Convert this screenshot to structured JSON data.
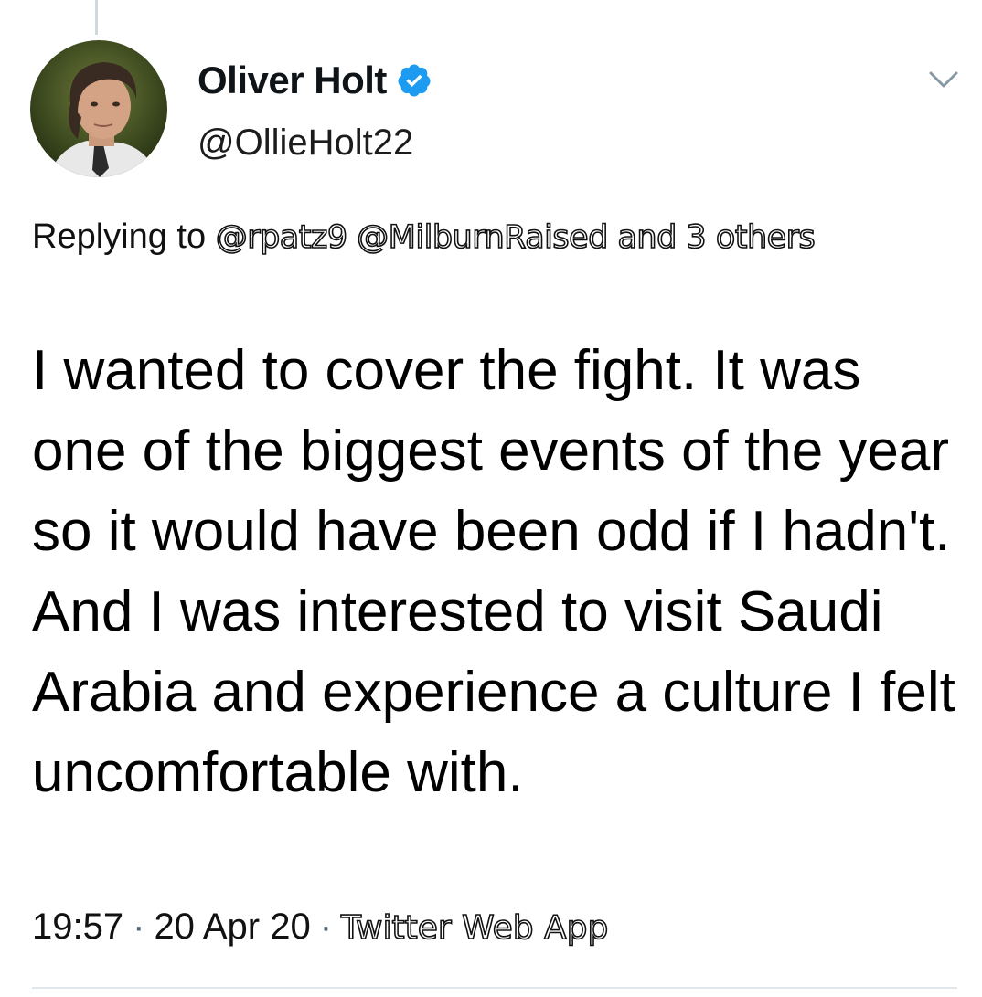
{
  "tweet": {
    "author": {
      "name": "Oliver Holt",
      "handle": "@OllieHolt22",
      "verified": true
    },
    "reply_context": {
      "prefix": "Replying to",
      "mentions": [
        "@rpatz9",
        "@MilburnRaised"
      ],
      "others": "and 3 others"
    },
    "text": "I wanted to cover the fight. It was one of the biggest events of the year so it would have been odd if I hadn't. And I was interested to visit Saudi Arabia and experience a culture I felt uncomfortable with.",
    "time": "19:57",
    "date": "20 Apr 20",
    "separator": "·",
    "source": "Twitter Web App"
  },
  "icons": {
    "verified": "verified-badge-icon",
    "more": "chevron-down-icon"
  },
  "colors": {
    "verified_blue": "#1d9bf0",
    "text": "#0f1419",
    "muted": "#536471",
    "divider": "#e1e6ea"
  }
}
